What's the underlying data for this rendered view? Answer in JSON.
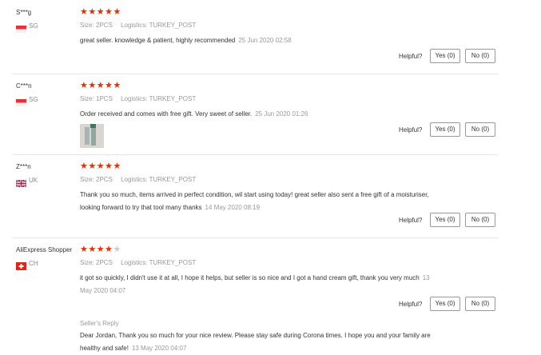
{
  "reviews": [
    {
      "user": "S***g",
      "country": "SG",
      "stars": 5,
      "size": "Size: 2PCS",
      "logistics": "Logistics: TURKEY_POST",
      "text": "great seller. knowledge & patient, highly recommended",
      "date": "25 Jun 2020 02:58",
      "helpful_label": "Helpful?",
      "yes": "Yes (0)",
      "no": "No (0)"
    },
    {
      "user": "C***n",
      "country": "SG",
      "stars": 5,
      "size": "Size: 1PCS",
      "logistics": "Logistics: TURKEY_POST",
      "text": "Order received and comes with free gift. Very sweet of seller.",
      "date": "25 Jun 2020 01:26",
      "helpful_label": "Helpful?",
      "yes": "Yes (0)",
      "no": "No (0)"
    },
    {
      "user": "Z***n",
      "country": "UK",
      "stars": 5,
      "size": "Size: 2PCS",
      "logistics": "Logistics: TURKEY_POST",
      "text": "Thank you so much, items arrived in perfect condition, wil start using today! great seller also sent a free gift of a moisturiser, looking forward to try that tool many thanks",
      "date": "14 May 2020 08:19",
      "helpful_label": "Helpful?",
      "yes": "Yes (0)",
      "no": "No (0)"
    },
    {
      "user": "AliExpress Shopper",
      "country": "CH",
      "stars": 4,
      "size": "Size: 2PCS",
      "logistics": "Logistics: TURKEY_POST",
      "text": "it got so quickly, I didn't use it at all, I hope it helps, but seller is so nice and I got a hand cream gift, thank you very much",
      "date": "13 May 2020 04:07",
      "helpful_label": "Helpful?",
      "yes": "Yes (0)",
      "no": "No (0)",
      "reply_label": "Seller's Reply",
      "reply_text": "Dear Jordan, Thank you so much for your nice review. Please stay safe during Corona times. I hope you and your family are healthy and safe!",
      "reply_date": "13 May 2020 04:07"
    }
  ],
  "colors": {
    "star": "#e62e04",
    "star_off": "#cccccc"
  }
}
